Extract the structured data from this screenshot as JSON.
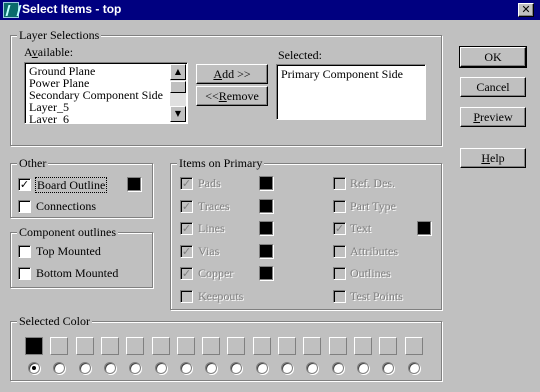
{
  "window": {
    "title": "Select Items - top",
    "close_glyph": "✕"
  },
  "layer_selections": {
    "label": "Layer Selections",
    "available_label": "Available:",
    "available_items": [
      "Ground Plane",
      "Power Plane",
      "Secondary Component Side",
      "Layer_5",
      "Layer_6"
    ],
    "add_label": "Add >>",
    "remove_label": "<<Remove",
    "selected_label": "Selected:",
    "selected_items": [
      "Primary Component Side"
    ]
  },
  "buttons": {
    "ok": "OK",
    "cancel": "Cancel",
    "preview": "Preview",
    "help": "Help"
  },
  "other": {
    "label": "Other",
    "board_outline": {
      "label": "Board Outline",
      "checked": true
    },
    "connections": {
      "label": "Connections",
      "checked": false
    }
  },
  "component_outlines": {
    "label": "Component outlines",
    "top_mounted": {
      "label": "Top Mounted",
      "checked": false
    },
    "bottom_mounted": {
      "label": "Bottom Mounted",
      "checked": false
    }
  },
  "items_on_primary": {
    "label": "Items on Primary",
    "left": [
      {
        "label": "Pads",
        "checked": true
      },
      {
        "label": "Traces",
        "checked": true
      },
      {
        "label": "Lines",
        "checked": true
      },
      {
        "label": "Vias",
        "checked": true
      },
      {
        "label": "Copper",
        "checked": true
      },
      {
        "label": "Keepouts",
        "checked": false
      }
    ],
    "right": [
      {
        "label": "Ref. Des.",
        "checked": false
      },
      {
        "label": "Part Type",
        "checked": false
      },
      {
        "label": "Text",
        "checked": true
      },
      {
        "label": "Attributes",
        "checked": false
      },
      {
        "label": "Outlines",
        "checked": false
      },
      {
        "label": "Test Points",
        "checked": false
      }
    ]
  },
  "selected_color": {
    "label": "Selected Color",
    "selected_index": 0,
    "swatch_count": 16
  },
  "colors": {
    "titlebar": "#000080",
    "face": "#c0c0c0",
    "swatch": "#000000"
  }
}
